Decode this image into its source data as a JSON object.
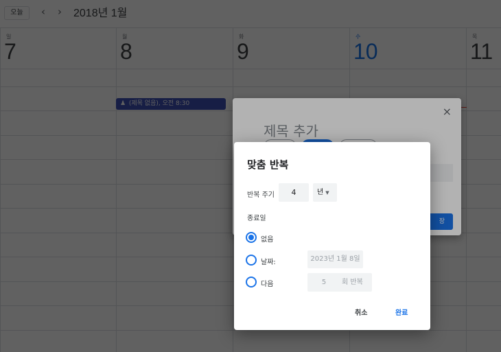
{
  "header": {
    "today_label": "오늘",
    "prev_icon": "‹",
    "next_icon": "›",
    "month_title": "2018년 1월"
  },
  "days": [
    {
      "weekday": "일",
      "date": "7"
    },
    {
      "weekday": "월",
      "date": "8"
    },
    {
      "weekday": "화",
      "date": "9"
    },
    {
      "weekday": "수",
      "date": "10",
      "today": true
    },
    {
      "weekday": "목",
      "date": "11"
    }
  ],
  "event": {
    "icon": "person-icon",
    "label": "(제목 없음), 오전 8:30"
  },
  "editor": {
    "close_icon": "×",
    "title_placeholder": "제목 추가",
    "save_label": "장"
  },
  "dialog": {
    "title": "맞춤 반복",
    "repeat_every_label": "반복 주기",
    "repeat_every_value": "4",
    "unit": "년",
    "ends_label": "종료일",
    "options": {
      "never": "없음",
      "on_date": "날짜:",
      "after": "다음"
    },
    "selected": "never",
    "end_date": "2023년 1월 8일",
    "occurrences": "5",
    "occurrences_suffix": "회 반복",
    "cancel_label": "취소",
    "done_label": "완료"
  },
  "colors": {
    "accent": "#1a73e8",
    "event": "#3f51b5"
  }
}
